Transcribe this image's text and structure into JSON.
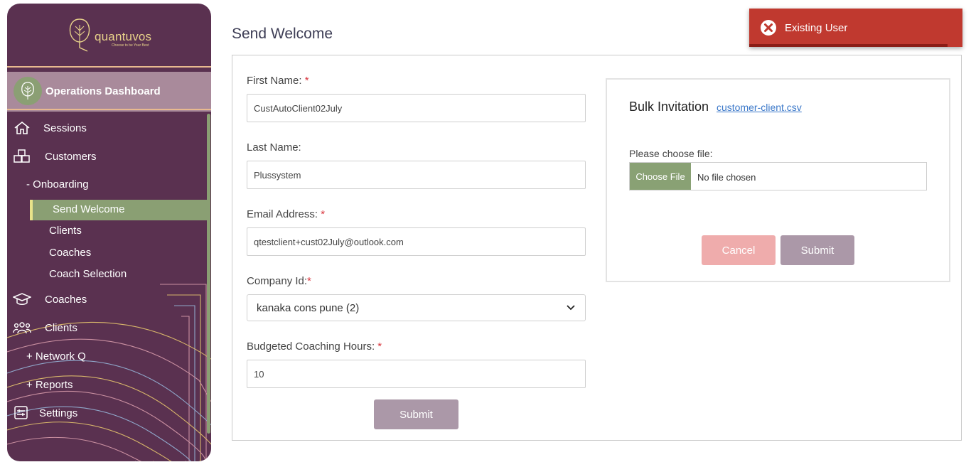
{
  "brand": {
    "name": "quantuvos",
    "tagline": "Choose to be Your Best"
  },
  "sidebar": {
    "dashboard_title": "Operations Dashboard",
    "items": [
      {
        "label": "Sessions",
        "icon": "home-icon"
      },
      {
        "label": "Customers",
        "icon": "boxes-icon"
      },
      {
        "label": "- Onboarding"
      },
      {
        "label": "Send Welcome",
        "active": true
      },
      {
        "label": "Clients"
      },
      {
        "label": "Coaches"
      },
      {
        "label": "Coach Selection"
      },
      {
        "label": "Coaches",
        "icon": "graduation-cap-icon"
      },
      {
        "label": "Clients",
        "icon": "users-icon"
      },
      {
        "label": "+ Network Q"
      },
      {
        "label": "+ Reports"
      },
      {
        "label": "Settings",
        "icon": "sliders-icon"
      }
    ]
  },
  "page": {
    "title": "Send Welcome"
  },
  "form": {
    "first_name": {
      "label": "First Name:",
      "required_mark": "*",
      "value": "CustAutoClient02July"
    },
    "last_name": {
      "label": "Last Name:",
      "value": "Plussystem"
    },
    "email": {
      "label": "Email Address:",
      "required_mark": "*",
      "value": "qtestclient+cust02July@outlook.com"
    },
    "company": {
      "label": "Company Id:",
      "required_mark": "*",
      "selected": "kanaka cons pune (2)"
    },
    "hours": {
      "label": "Budgeted Coaching Hours:",
      "required_mark": "*",
      "value": "10"
    },
    "submit_label": "Submit"
  },
  "bulk": {
    "title": "Bulk Invitation",
    "link_text": "customer-client.csv",
    "file_label": "Please choose file:",
    "choose_button": "Choose File",
    "no_file_text": "No file chosen",
    "cancel_label": "Cancel",
    "submit_label": "Submit"
  },
  "toast": {
    "message": "Existing User"
  },
  "colors": {
    "sidebar_bg": "#5a3150",
    "accent_green": "#8a9f73",
    "submit_bg": "#ab98a8",
    "cancel_bg": "#efacac",
    "toast_bg": "#c0392f"
  }
}
